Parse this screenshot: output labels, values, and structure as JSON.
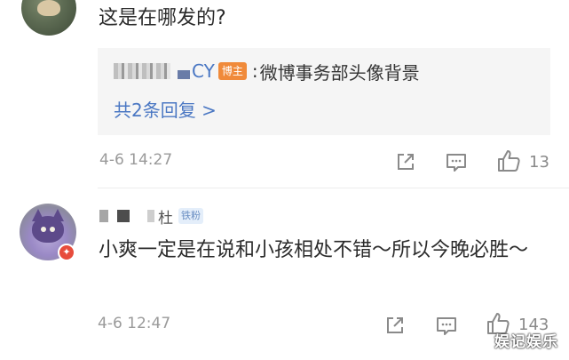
{
  "comments": [
    {
      "text": "这是在哪发的?",
      "reply": {
        "author_suffix": "CY",
        "author_badge": "博主",
        "colon": ":",
        "text": "微博事务部头像背景",
        "more_label": "共2条回复 >"
      },
      "time": "4-6 14:27",
      "like_count": "13"
    },
    {
      "author_suffix": "杜",
      "author_badge": "铁粉",
      "text": "小爽一定是在说和小孩相处不错～所以今晚必胜～",
      "time": "4-6 12:47",
      "like_count": "143"
    }
  ],
  "watermark": "娱记娱乐",
  "colors": {
    "link_blue": "#4a77c3",
    "owner_badge": "#f08a3a",
    "fan_badge_bg": "#e4eefa",
    "meta_gray": "#9a9a9a"
  },
  "icons": [
    "share-icon",
    "comment-icon",
    "like-icon"
  ]
}
